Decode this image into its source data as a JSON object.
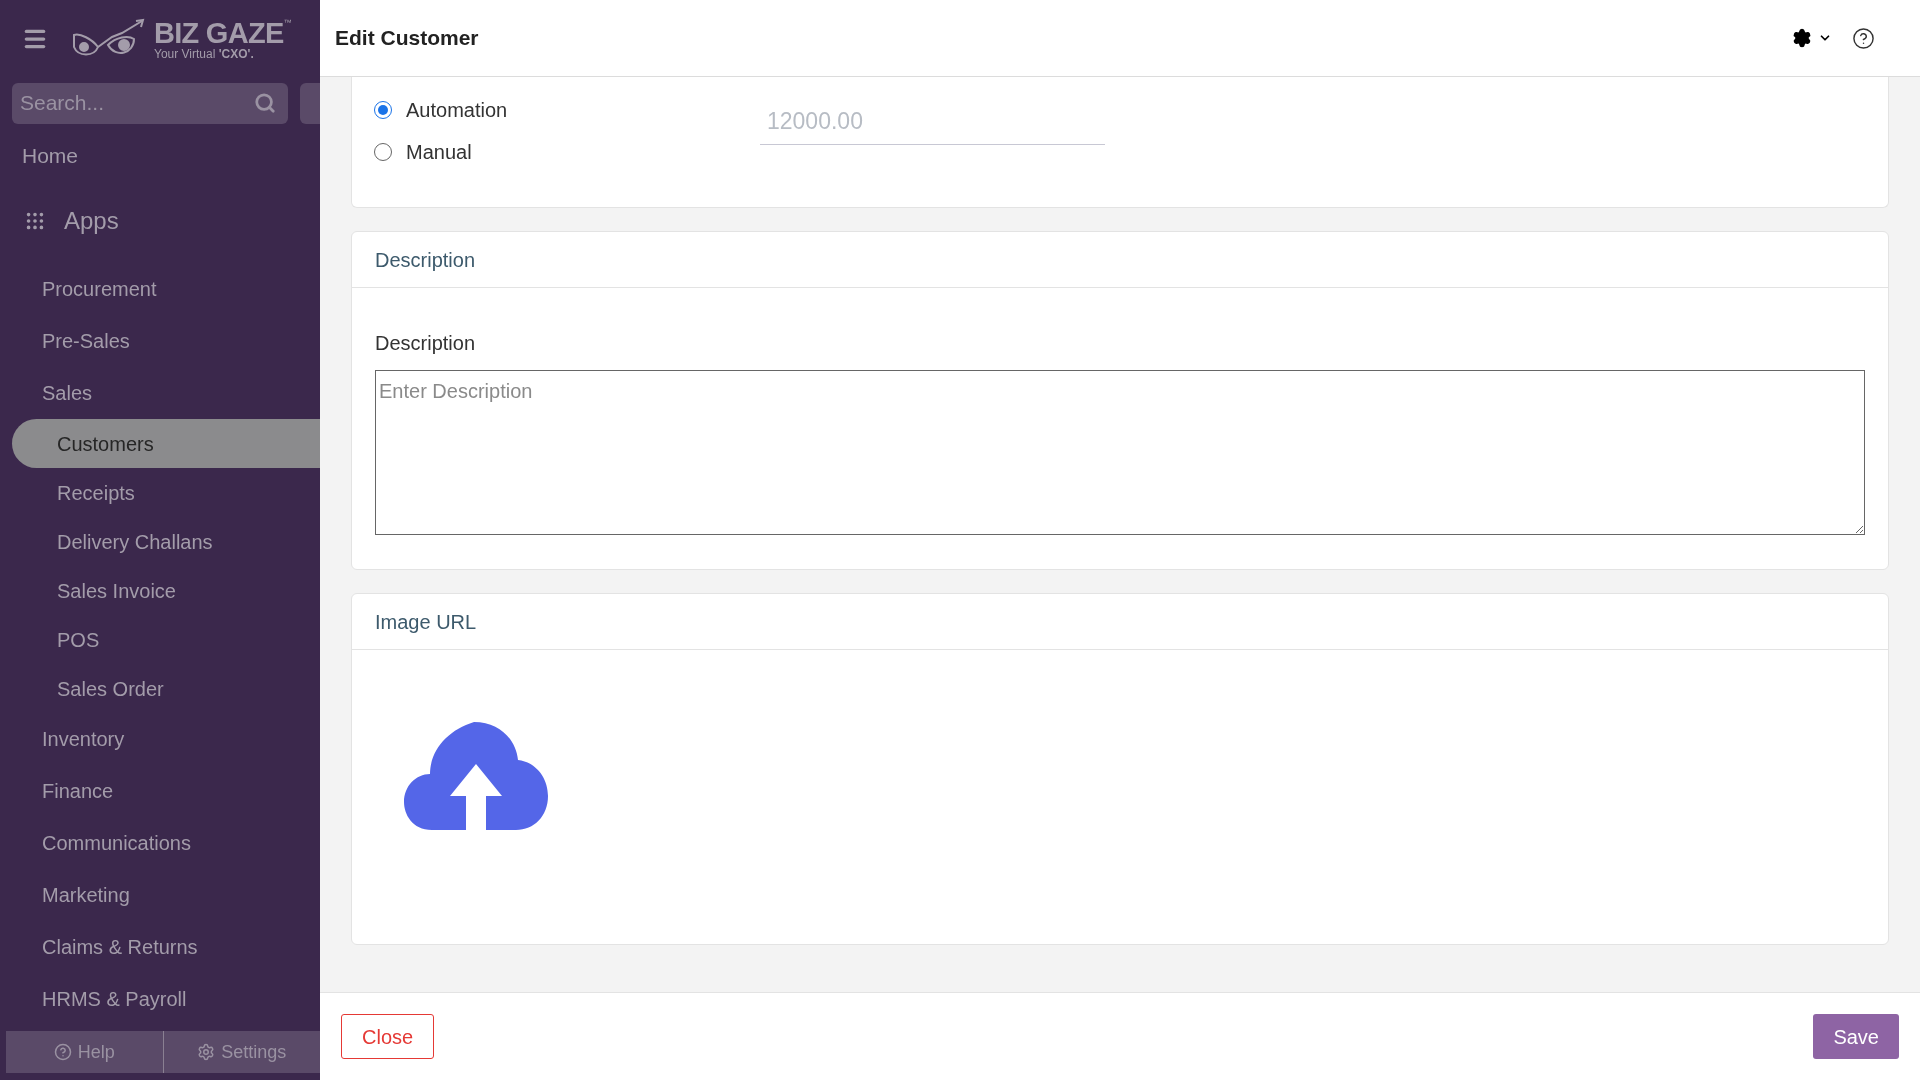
{
  "sidebar": {
    "logo": {
      "name": "BIZ GAZE",
      "trademark": "™",
      "tagline": "Your Virtual ",
      "tagline_bold": "'CXO'."
    },
    "search": {
      "placeholder": "Search..."
    },
    "home": "Home",
    "apps_title": "Apps",
    "items": [
      {
        "label": "Procurement",
        "selected": false
      },
      {
        "label": "Pre-Sales",
        "selected": false
      },
      {
        "label": "Sales",
        "selected": false,
        "children": [
          {
            "label": "Customers",
            "selected": true
          },
          {
            "label": "Receipts",
            "selected": false
          },
          {
            "label": "Delivery Challans",
            "selected": false
          },
          {
            "label": "Sales Invoice",
            "selected": false
          },
          {
            "label": "POS",
            "selected": false
          },
          {
            "label": "Sales Order",
            "selected": false
          }
        ]
      },
      {
        "label": "Inventory",
        "selected": false
      },
      {
        "label": "Finance",
        "selected": false
      },
      {
        "label": "Communications",
        "selected": false
      },
      {
        "label": "Marketing",
        "selected": false
      },
      {
        "label": "Claims & Returns",
        "selected": false
      },
      {
        "label": "HRMS & Payroll",
        "selected": false
      }
    ],
    "footer": [
      {
        "label": "Help",
        "kind": "help"
      },
      {
        "label": "Settings",
        "kind": "settings"
      }
    ]
  },
  "drawer": {
    "title": "Edit Customer",
    "mode_options": [
      {
        "label": "Automation",
        "selected": true
      },
      {
        "label": "Manual",
        "selected": false
      }
    ],
    "credit_limit": {
      "value": "12000.00",
      "disabled": true
    },
    "description_section": {
      "title": "Description",
      "label": "Description",
      "placeholder": "Enter Description"
    },
    "image_section": {
      "title": "Image URL"
    },
    "buttons": [
      {
        "label": "Close",
        "kind": "secondary"
      },
      {
        "label": "Save",
        "kind": "primary"
      }
    ]
  }
}
